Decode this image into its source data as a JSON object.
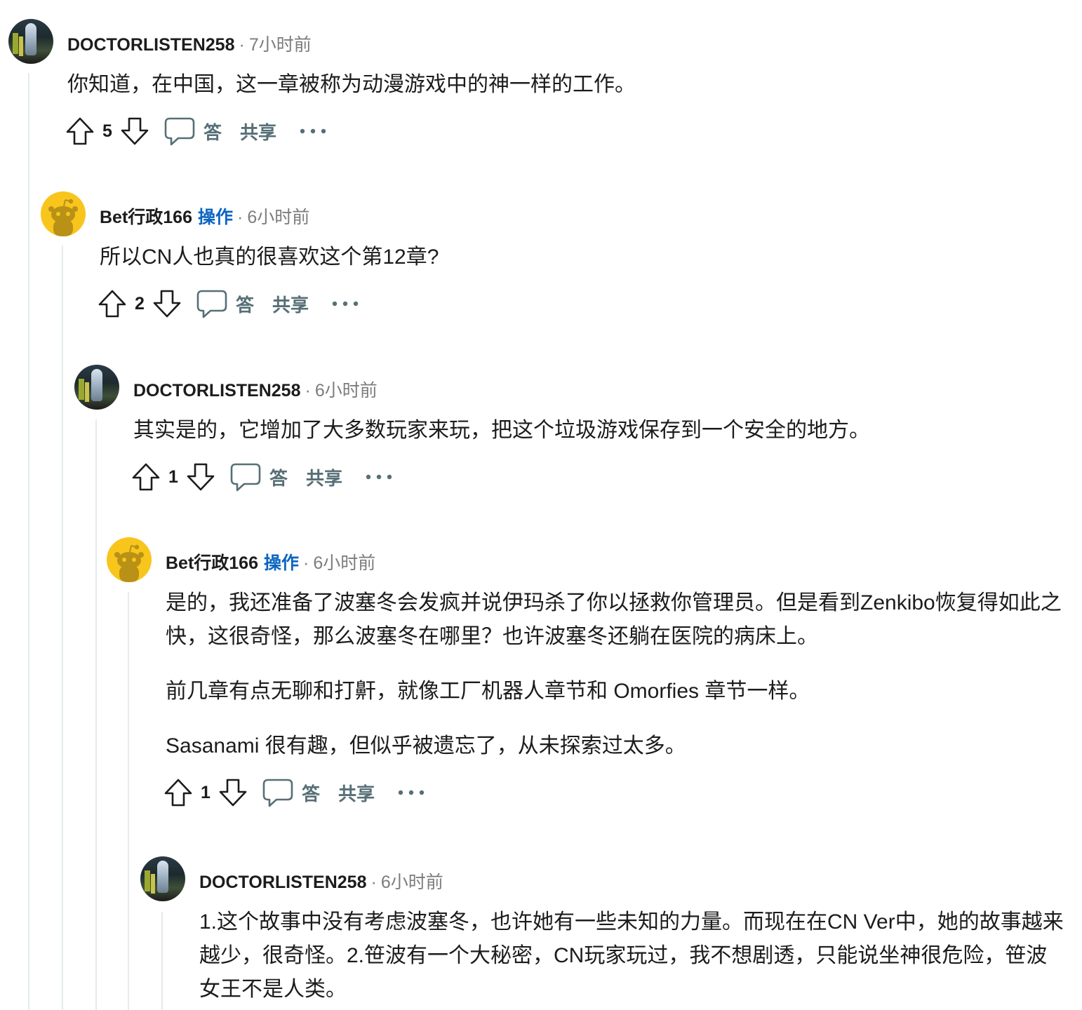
{
  "comments": [
    {
      "author": "DOCTORLISTEN258",
      "is_op": false,
      "op_label": "",
      "time": "7小时前",
      "paragraphs": [
        "你知道，在中国，这一章被称为动漫游戏中的神一样的工作。"
      ],
      "votes": "5",
      "reply_label": "答",
      "share_label": "共享"
    },
    {
      "author": "Bet行政166",
      "is_op": true,
      "op_label": "操作",
      "time": "6小时前",
      "paragraphs": [
        "所以CN人也真的很喜欢这个第12章?"
      ],
      "votes": "2",
      "reply_label": "答",
      "share_label": "共享"
    },
    {
      "author": "DOCTORLISTEN258",
      "is_op": false,
      "op_label": "",
      "time": "6小时前",
      "paragraphs": [
        "其实是的，它增加了大多数玩家来玩，把这个垃圾游戏保存到一个安全的地方。"
      ],
      "votes": "1",
      "reply_label": "答",
      "share_label": "共享"
    },
    {
      "author": "Bet行政166",
      "is_op": true,
      "op_label": "操作",
      "time": "6小时前",
      "paragraphs": [
        "是的，我还准备了波塞冬会发疯并说伊玛杀了你以拯救你管理员。但是看到Zenkibo恢复得如此之快，这很奇怪，那么波塞冬在哪里？也许波塞冬还躺在医院的病床上。",
        "前几章有点无聊和打鼾，就像工厂机器人章节和 Omorfies 章节一样。",
        "Sasanami 很有趣，但似乎被遗忘了，从未探索过太多。"
      ],
      "votes": "1",
      "reply_label": "答",
      "share_label": "共享"
    },
    {
      "author": "DOCTORLISTEN258",
      "is_op": false,
      "op_label": "",
      "time": "6小时前",
      "paragraphs": [
        "1.这个故事中没有考虑波塞冬，也许她有一些未知的力量。而现在在CN Ver中，她的故事越来越少，很奇怪。2.笹波有一个大秘密，CN玩家玩过，我不想剧透，只能说坐神很危险，笹波女王不是人类。"
      ]
    }
  ],
  "meta_separator": "·",
  "icons": {
    "upvote": "upvote-arrow-icon",
    "downvote": "downvote-arrow-icon",
    "reply": "speech-bubble-icon",
    "more": "ellipsis-icon",
    "snoo_avatar": "snoo-avatar-icon"
  },
  "colors": {
    "op_tag": "#0a65c2",
    "muted": "#7c7c7c",
    "action_text": "#576f76",
    "thread_line": "#e5ebee",
    "snoo_bg": "#f8c51c"
  }
}
